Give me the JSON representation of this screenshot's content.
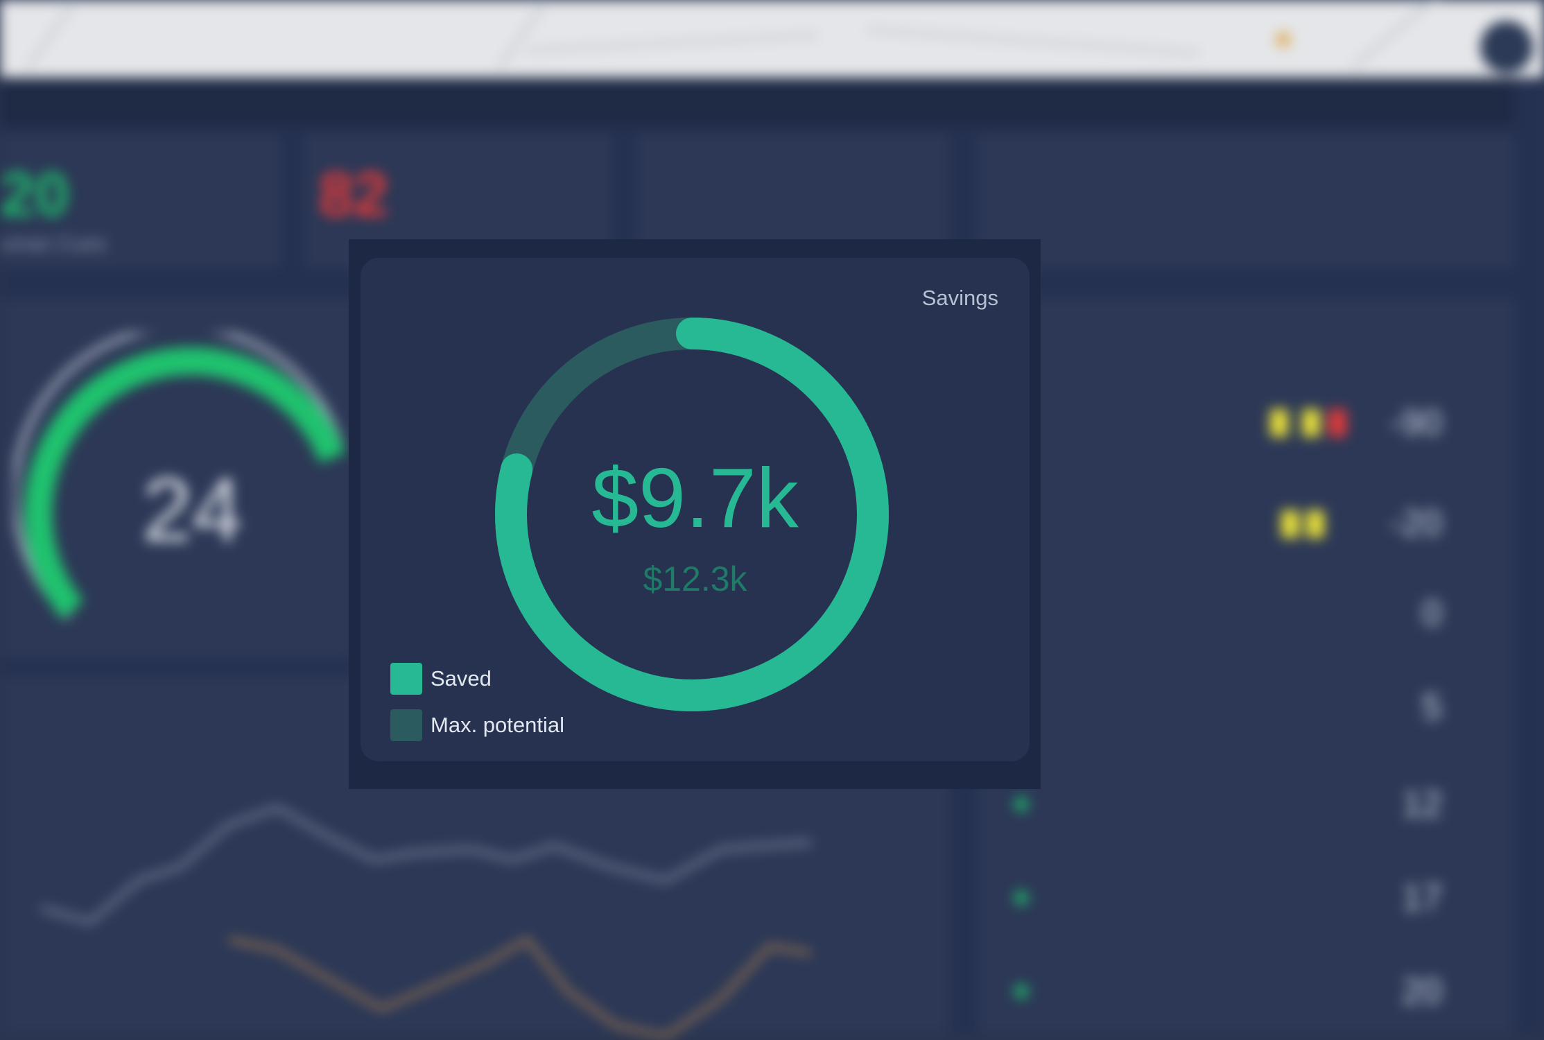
{
  "background": {
    "stats": [
      {
        "value": "20",
        "label": "uman Cues",
        "color": "#1fb56b"
      },
      {
        "value": "82",
        "label": "",
        "color": "#e03a3a"
      }
    ],
    "gauge_value": "24",
    "rows": [
      {
        "value": "-90"
      },
      {
        "value": "-20"
      },
      {
        "value": "0"
      },
      {
        "value": "5"
      },
      {
        "value": "12"
      },
      {
        "value": "17"
      },
      {
        "value": "20"
      }
    ]
  },
  "savings_card": {
    "title": "Savings",
    "saved_value": "$9.7k",
    "max_potential_value": "$12.3k",
    "saved_fraction": 0.79,
    "colors": {
      "saved": "#26b994",
      "max_potential": "#2b5b5e"
    },
    "legend": [
      {
        "label": "Saved",
        "color": "#26b994"
      },
      {
        "label": "Max. potential",
        "color": "#2b5b5e"
      }
    ]
  }
}
